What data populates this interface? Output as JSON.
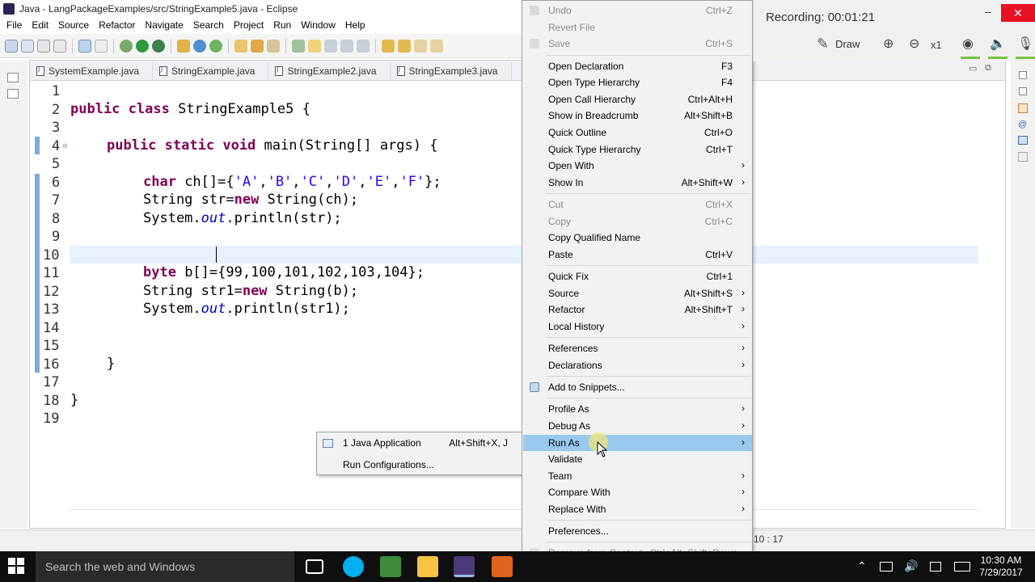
{
  "window": {
    "title": "Java - LangPackageExamples/src/StringExample5.java - Eclipse"
  },
  "menubar": [
    "File",
    "Edit",
    "Source",
    "Refactor",
    "Navigate",
    "Search",
    "Project",
    "Run",
    "Window",
    "Help"
  ],
  "tabs": [
    "SystemExample.java",
    "StringExample.java",
    "StringExample2.java",
    "StringExample3.java"
  ],
  "code": {
    "line_numbers": [
      "1",
      "2",
      "3",
      "4",
      "5",
      "6",
      "7",
      "8",
      "9",
      "10",
      "11",
      "12",
      "13",
      "14",
      "15",
      "16",
      "17",
      "18",
      "19"
    ],
    "lines": {
      "l2": {
        "kw1": "public",
        "kw2": "class",
        "rest": " StringExample5 {"
      },
      "l4": {
        "kw1": "public",
        "kw2": "static",
        "kw3": "void",
        "rest": " main(String[] args) {"
      },
      "l6": {
        "kw": "char",
        "p1": " ch[]={",
        "s1": "'A'",
        "s2": "'B'",
        "s3": "'C'",
        "s4": "'D'",
        "s5": "'E'",
        "s6": "'F'",
        "end": "};",
        "comma": ","
      },
      "l7": {
        "p1": "String str=",
        "kw": "new",
        "p2": " String(ch);"
      },
      "l8": {
        "p1": "System.",
        "fld": "out",
        "p2": ".println(str);"
      },
      "l11": {
        "kw": "byte",
        "rest": " b[]={99,100,101,102,103,104};"
      },
      "l12": {
        "p1": "String str1=",
        "kw": "new",
        "p2": " String(b);"
      },
      "l13": {
        "p1": "System.",
        "fld": "out",
        "p2": ".println(str1);"
      },
      "l16": "}",
      "l18": "}"
    }
  },
  "status": {
    "position": "10 : 17"
  },
  "run_submenu": [
    {
      "label": "1 Java Application",
      "shortcut": "Alt+Shift+X, J"
    },
    {
      "label": "Run Configurations..."
    }
  ],
  "context_menu": {
    "undo": {
      "label": "Undo",
      "shortcut": "Ctrl+Z"
    },
    "revert": {
      "label": "Revert File"
    },
    "save": {
      "label": "Save",
      "shortcut": "Ctrl+S"
    },
    "open_declaration": {
      "label": "Open Declaration",
      "shortcut": "F3"
    },
    "open_type_hierarchy": {
      "label": "Open Type Hierarchy",
      "shortcut": "F4"
    },
    "open_call_hierarchy": {
      "label": "Open Call Hierarchy",
      "shortcut": "Ctrl+Alt+H"
    },
    "show_breadcrumb": {
      "label": "Show in Breadcrumb",
      "shortcut": "Alt+Shift+B"
    },
    "quick_outline": {
      "label": "Quick Outline",
      "shortcut": "Ctrl+O"
    },
    "quick_type_hierarchy": {
      "label": "Quick Type Hierarchy",
      "shortcut": "Ctrl+T"
    },
    "open_with": {
      "label": "Open With"
    },
    "show_in": {
      "label": "Show In",
      "shortcut": "Alt+Shift+W"
    },
    "cut": {
      "label": "Cut",
      "shortcut": "Ctrl+X"
    },
    "copy": {
      "label": "Copy",
      "shortcut": "Ctrl+C"
    },
    "copy_qualified": {
      "label": "Copy Qualified Name"
    },
    "paste": {
      "label": "Paste",
      "shortcut": "Ctrl+V"
    },
    "quick_fix": {
      "label": "Quick Fix",
      "shortcut": "Ctrl+1"
    },
    "source": {
      "label": "Source",
      "shortcut": "Alt+Shift+S"
    },
    "refactor": {
      "label": "Refactor",
      "shortcut": "Alt+Shift+T"
    },
    "local_history": {
      "label": "Local History"
    },
    "references": {
      "label": "References"
    },
    "declarations": {
      "label": "Declarations"
    },
    "add_snippets": {
      "label": "Add to Snippets..."
    },
    "profile_as": {
      "label": "Profile As"
    },
    "debug_as": {
      "label": "Debug As"
    },
    "run_as": {
      "label": "Run As"
    },
    "validate": {
      "label": "Validate"
    },
    "team": {
      "label": "Team"
    },
    "compare_with": {
      "label": "Compare With"
    },
    "replace_with": {
      "label": "Replace With"
    },
    "preferences": {
      "label": "Preferences..."
    },
    "remove_context": {
      "label": "Remove from Context",
      "shortcut": "Ctrl+Alt+Shift+Down"
    },
    "arrow": "›"
  },
  "recording": {
    "label": "Recording:  00:01:21",
    "draw": "Draw",
    "zoom": "x1",
    "minimize": "–",
    "close": "✕"
  },
  "taskbar": {
    "search_placeholder": "Search the web and Windows",
    "time": "10:30 AM",
    "date": "7/29/2017"
  },
  "colors": {
    "keyword": "#7f0055",
    "string": "#2a00ff",
    "field": "#0000c0",
    "menu_hover": "#99c9ef",
    "record_close": "#e81123"
  }
}
